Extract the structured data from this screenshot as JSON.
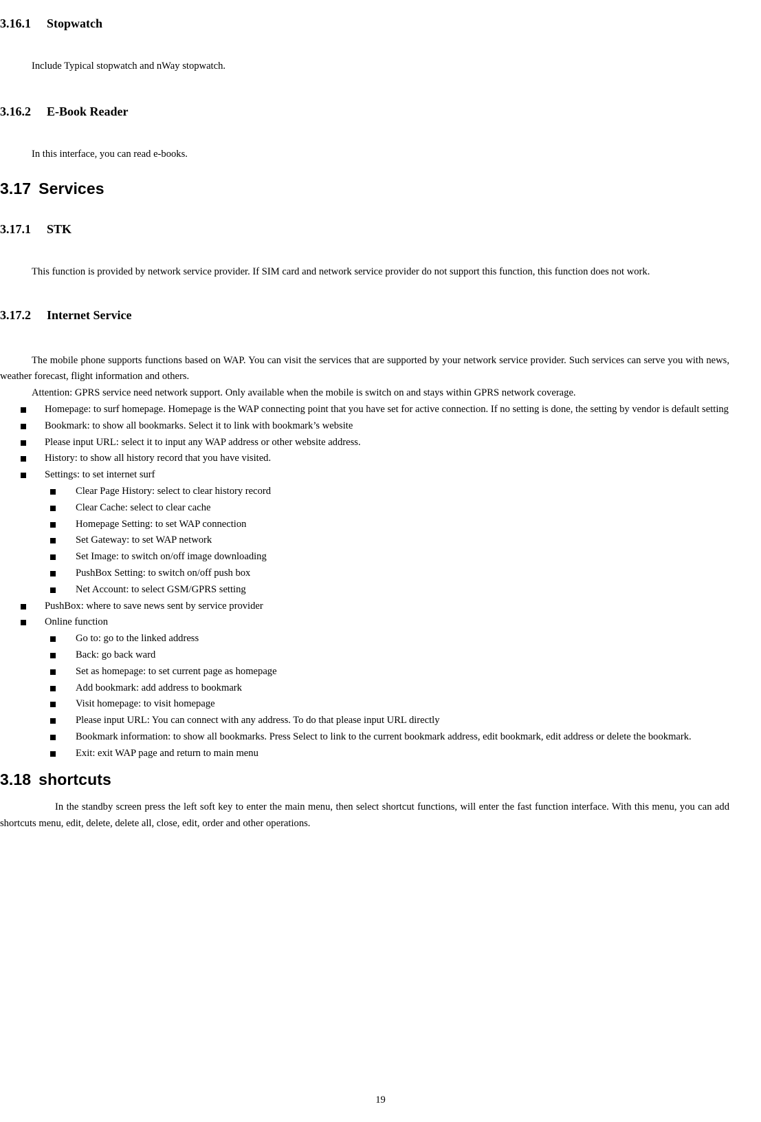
{
  "page": {
    "number": "19",
    "sections": [
      {
        "id": "stopwatch",
        "heading_level": 3,
        "number": "3.16.1",
        "title": "Stopwatch",
        "body": "Include Typical stopwatch and nWay stopwatch."
      },
      {
        "id": "ebook-reader",
        "heading_level": 3,
        "number": "3.16.2",
        "title": "E-Book Reader",
        "body": "In this interface, you can read e-books."
      },
      {
        "id": "services",
        "heading_level": 2,
        "number": "3.17",
        "title": "Services"
      },
      {
        "id": "stk",
        "heading_level": 3,
        "number": "3.17.1",
        "title": "STK",
        "body": "This function is provided by network service provider. If SIM card and network service provider do not support this function, this function does not work."
      },
      {
        "id": "internet-service",
        "heading_level": 3,
        "number": "3.17.2",
        "title": "Internet Service",
        "body": "The mobile phone supports functions based on WAP. You can visit the services that are supported by your network service provider. Such services can serve you with news, weather forecast, flight information and others.",
        "attention": "Attention: GPRS service need network support. Only available when the mobile is switch on and stays within GPRS network coverage."
      },
      {
        "id": "shortcuts",
        "heading_level": 2,
        "number": "3.18",
        "title": "shortcuts",
        "body": "In the standby screen press the left soft key to enter the main menu, then select shortcut functions, will enter the fast function interface. With this menu, you can add shortcuts menu, edit, delete, delete all, close, edit, order and other operations."
      }
    ],
    "internet_service_list": [
      {
        "text": "Homepage: to surf homepage. Homepage is the WAP connecting point that you have set for active connection. If no setting is done, the setting by vendor is default setting",
        "children": []
      },
      {
        "text": "Bookmark: to show all bookmarks. Select it to link with bookmark’s website",
        "children": []
      },
      {
        "text": "Please input URL: select it to input any WAP address or other website address.",
        "children": []
      },
      {
        "text": "History: to show all history record that you have visited.",
        "children": []
      },
      {
        "text": "Settings: to set internet surf",
        "children": [
          "Clear Page History: select to clear history record",
          "Clear Cache: select to clear cache",
          "Homepage Setting: to set WAP connection",
          "Set Gateway: to set WAP network",
          "Set Image: to switch on/off image downloading",
          "PushBox Setting: to switch on/off push box",
          "Net Account: to select GSM/GPRS setting"
        ]
      },
      {
        "text": "PushBox: where to save news sent by service provider",
        "children": []
      },
      {
        "text": "Online function",
        "children": [
          "Go to: go to the linked address",
          "Back: go back ward",
          "Set as homepage: to set current page as homepage",
          "Add bookmark: add address to bookmark",
          "Visit homepage: to visit homepage",
          "Please input URL: You can connect with any address. To do that please input URL directly",
          "Bookmark information: to show all bookmarks. Press Select to link to the current bookmark address, edit bookmark, edit address or delete the bookmark.",
          "Exit: exit WAP page and return to main menu"
        ]
      }
    ]
  }
}
